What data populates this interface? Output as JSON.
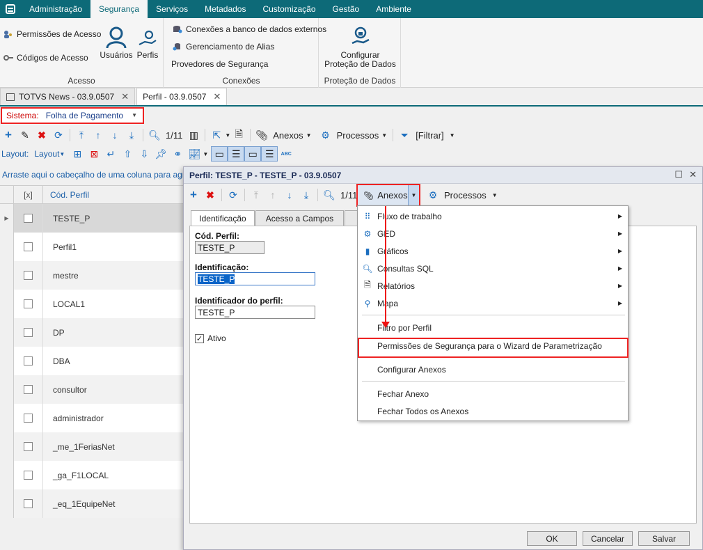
{
  "menubar": {
    "tabs": [
      "Administração",
      "Segurança",
      "Serviços",
      "Metadados",
      "Customização",
      "Gestão",
      "Ambiente"
    ]
  },
  "ribbon": {
    "acesso": {
      "items": [
        "Permissões de Acesso",
        "Códigos de Acesso"
      ],
      "big": [
        "Usuários",
        "Perfis"
      ],
      "label": "Acesso"
    },
    "conexoes": {
      "items": [
        "Conexões a banco de dados externos",
        "Gerenciamento de Alias",
        "Provedores de Segurança"
      ],
      "label": "Conexões"
    },
    "protecao": {
      "big_line1": "Configurar",
      "big_line2": "Proteção de Dados",
      "label": "Proteção de Dados"
    }
  },
  "doctabs": [
    {
      "label": "TOTVS News - 03.9.0507"
    },
    {
      "label": "Perfil - 03.9.0507"
    }
  ],
  "sistema": {
    "label": "Sistema:",
    "value": "Folha de Pagamento"
  },
  "toolbar": {
    "counter": "1/11",
    "anexos": "Anexos",
    "processos": "Processos",
    "filtrar": "[Filtrar]"
  },
  "layoutbar": {
    "label": "Layout:",
    "layout_btn": "Layout"
  },
  "grid": {
    "group_hint": "Arraste aqui o cabeçalho de uma coluna para agrupar",
    "col_check": "[x]",
    "col_cod": "Cód. Perfil",
    "rows": [
      "TESTE_P",
      "Perfil1",
      "mestre",
      "LOCAL1",
      "DP",
      "DBA",
      "consultor",
      "administrador",
      "_me_1FeriasNet",
      "_ga_F1LOCAL",
      "_eq_1EquipeNet"
    ]
  },
  "dialog": {
    "title": "Perfil: TESTE_P - TESTE_P - 03.9.0507",
    "counter": "1/11",
    "anexos": "Anexos",
    "processos": "Processos",
    "tabs": [
      "Identificação",
      "Acesso a Campos"
    ],
    "fields": {
      "cod_label": "Cód. Perfil:",
      "cod_value": "TESTE_P",
      "ident_label": "Identificação:",
      "ident_value": "TESTE_P",
      "identp_label": "Identificador do perfil:",
      "identp_value": "TESTE_P",
      "ativo_label": "Ativo"
    },
    "buttons": {
      "ok": "OK",
      "cancel": "Cancelar",
      "save": "Salvar"
    }
  },
  "menu": {
    "items": [
      "Fluxo de trabalho",
      "GED",
      "Gráficos",
      "Consultas SQL",
      "Relatórios",
      "Mapa",
      "Filtro por Perfil",
      "Permissões de Segurança para o Wizard de Parametrização",
      "Configurar Anexos",
      "Fechar Anexo",
      "Fechar Todos os Anexos"
    ]
  },
  "colors": {
    "brand": "#0d6a78",
    "highlight": "#e22222",
    "link": "#1b5fa8"
  }
}
